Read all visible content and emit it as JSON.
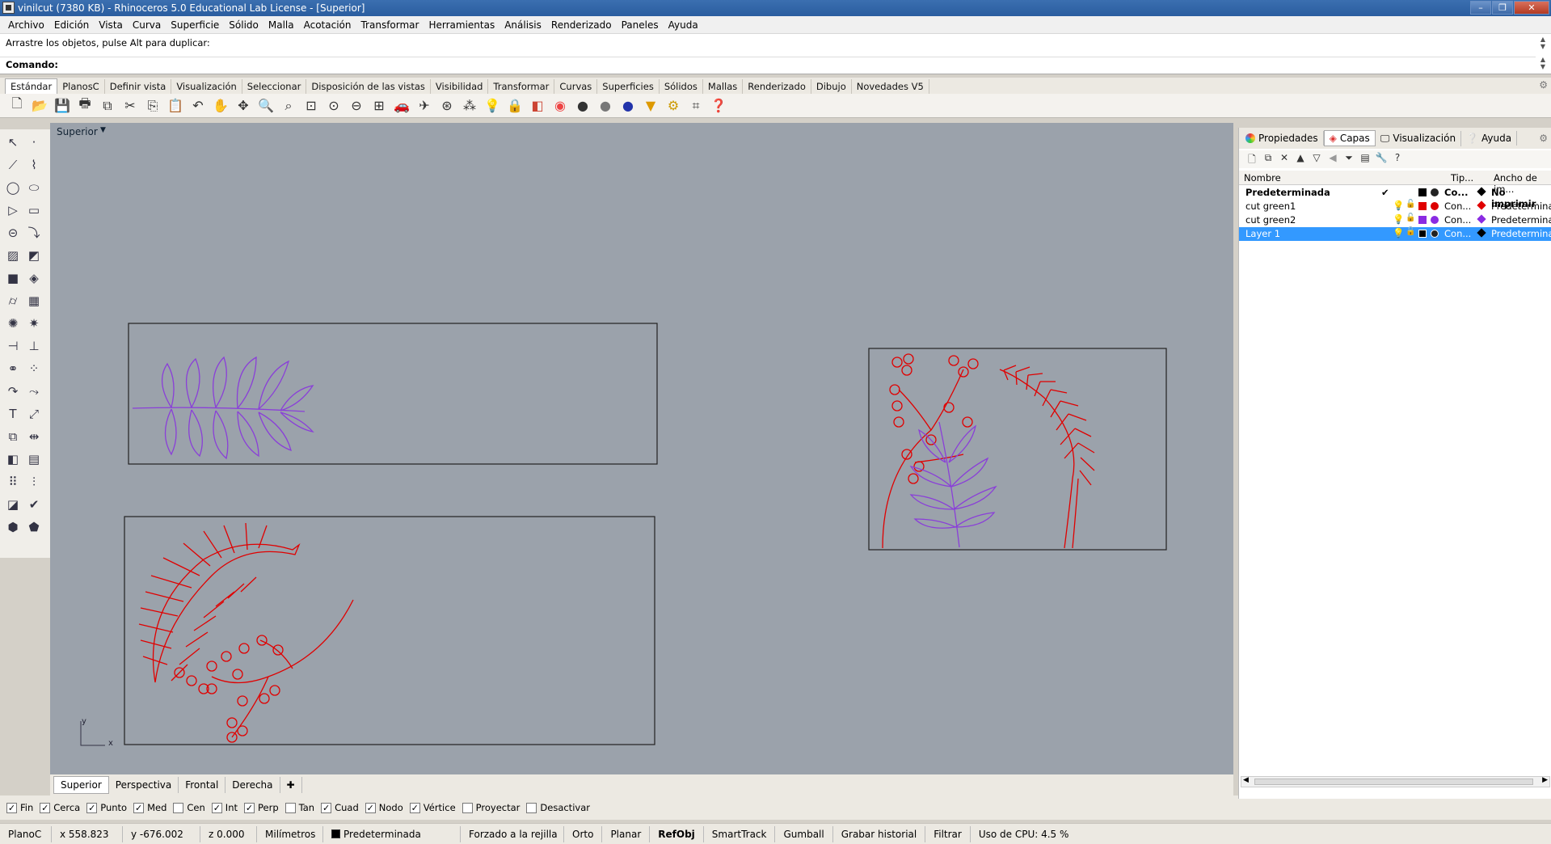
{
  "window": {
    "title": "vinilcut (7380 KB) - Rhinoceros 5.0 Educational Lab License - [Superior]"
  },
  "menu": [
    "Archivo",
    "Edición",
    "Vista",
    "Curva",
    "Superficie",
    "Sólido",
    "Malla",
    "Acotación",
    "Transformar",
    "Herramientas",
    "Análisis",
    "Renderizado",
    "Paneles",
    "Ayuda"
  ],
  "command": {
    "history": "Arrastre los objetos, pulse Alt para duplicar:",
    "prompt": "Comando:",
    "input": ""
  },
  "toolbar_tabs": [
    "Estándar",
    "PlanosC",
    "Definir vista",
    "Visualización",
    "Seleccionar",
    "Disposición de las vistas",
    "Visibilidad",
    "Transformar",
    "Curvas",
    "Superficies",
    "Sólidos",
    "Mallas",
    "Renderizado",
    "Dibujo",
    "Novedades V5"
  ],
  "viewport": {
    "name": "Superior",
    "axis_y": "y",
    "axis_x": "x"
  },
  "viewport_tabs": [
    "Superior",
    "Perspectiva",
    "Frontal",
    "Derecha"
  ],
  "osnaps": [
    {
      "label": "Fin",
      "checked": true
    },
    {
      "label": "Cerca",
      "checked": true
    },
    {
      "label": "Punto",
      "checked": true
    },
    {
      "label": "Med",
      "checked": true
    },
    {
      "label": "Cen",
      "checked": false
    },
    {
      "label": "Int",
      "checked": true
    },
    {
      "label": "Perp",
      "checked": true
    },
    {
      "label": "Tan",
      "checked": false
    },
    {
      "label": "Cuad",
      "checked": true
    },
    {
      "label": "Nodo",
      "checked": true
    },
    {
      "label": "Vértice",
      "checked": true
    },
    {
      "label": "Proyectar",
      "checked": false
    },
    {
      "label": "Desactivar",
      "checked": false
    }
  ],
  "status": {
    "cplane": "PlanoC",
    "x": "x 558.823",
    "y": "y -676.002",
    "z": "z 0.000",
    "units": "Milímetros",
    "layer": "Predeterminada",
    "grid_snap": "Forzado a la rejilla",
    "ortho": "Orto",
    "planar": "Planar",
    "refobj": "RefObj",
    "smarttrack": "SmartTrack",
    "gumball": "Gumball",
    "history": "Grabar historial",
    "filter": "Filtrar",
    "cpu": "Uso de CPU: 4.5 %"
  },
  "panel": {
    "tabs": [
      "Propiedades",
      "Capas",
      "Visualización",
      "Ayuda"
    ],
    "active_tab": "Capas",
    "columns": {
      "name": "Nombre",
      "type": "Tip...",
      "width": "Ancho de im..."
    },
    "layers": [
      {
        "name": "Predeterminada",
        "current": "✔",
        "color": "#000000",
        "material": "Co...",
        "print": "No imprimir",
        "bold": true
      },
      {
        "name": "cut green1",
        "current": "",
        "color": "#e00000",
        "material": "Con...",
        "print": "Predeterminado",
        "bold": false
      },
      {
        "name": "cut green2",
        "current": "",
        "color": "#8a2be2",
        "material": "Con...",
        "print": "Predeterminado",
        "bold": false
      },
      {
        "name": "Layer 1",
        "current": "",
        "color": "#000000",
        "material": "Con...",
        "print": "Predeterminado",
        "bold": false,
        "selected": true
      }
    ]
  },
  "colors": {
    "viewport_bg": "#9ba2ab",
    "curve_red": "#e00000",
    "curve_purple": "#8a3fd8",
    "selection": "#3399ff"
  }
}
